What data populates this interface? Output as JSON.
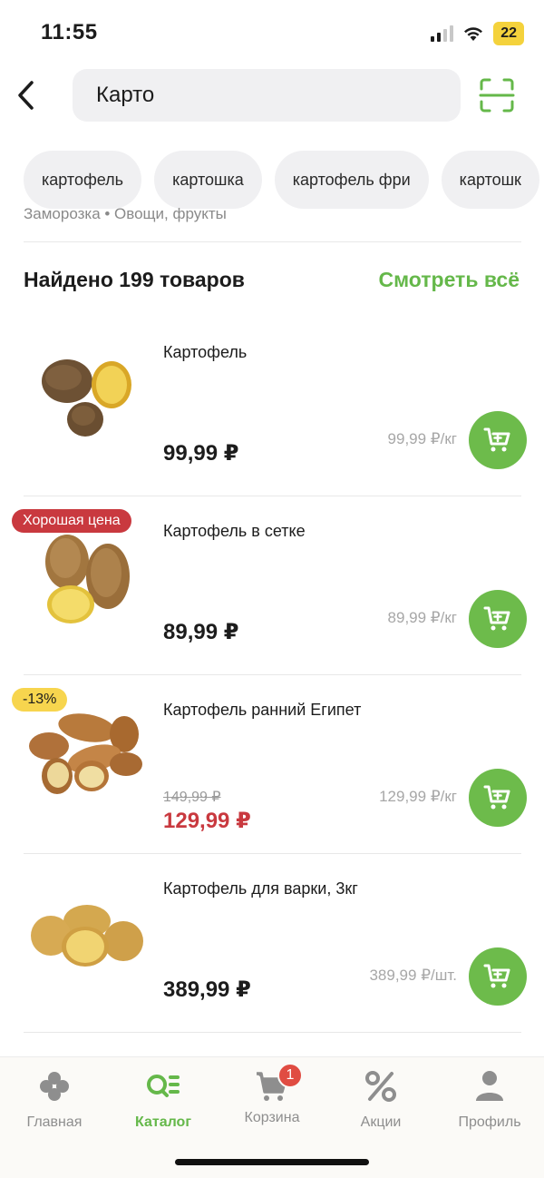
{
  "status": {
    "time": "11:55",
    "battery": "22"
  },
  "search": {
    "value": "Карто",
    "placeholder": ""
  },
  "chips": [
    "картофель",
    "картошка",
    "картофель фри",
    "картошк"
  ],
  "category_hint": "Заморозка • Овощи, фрукты",
  "results": {
    "title": "Найдено 199 товаров",
    "see_all": "Смотреть всё"
  },
  "products": [
    {
      "name": "Картофель",
      "price": "99,99 ₽",
      "unit_price": "99,99 ₽/кг",
      "badge": "",
      "old_price": ""
    },
    {
      "name": "Картофель в сетке",
      "price": "89,99 ₽",
      "unit_price": "89,99 ₽/кг",
      "badge": "Хорошая цена",
      "old_price": ""
    },
    {
      "name": "Картофель ранний Египет",
      "price": "129,99 ₽",
      "unit_price": "129,99 ₽/кг",
      "badge": "-13%",
      "old_price": "149,99 ₽"
    },
    {
      "name": "Картофель для варки, 3кг",
      "price": "389,99 ₽",
      "unit_price": "389,99 ₽/шт.",
      "badge": "",
      "old_price": ""
    }
  ],
  "nav": {
    "items": [
      {
        "label": "Главная",
        "icon": "clover-icon"
      },
      {
        "label": "Каталог",
        "icon": "catalog-search-icon"
      },
      {
        "label": "Корзина",
        "icon": "cart-icon"
      },
      {
        "label": "Акции",
        "icon": "percent-icon"
      },
      {
        "label": "Профиль",
        "icon": "user-icon"
      }
    ],
    "active": "Каталог",
    "cart_count": "1"
  },
  "colors": {
    "accent": "#65b84a",
    "sale": "#c9393f",
    "badge_yellow": "#f7d54e"
  }
}
